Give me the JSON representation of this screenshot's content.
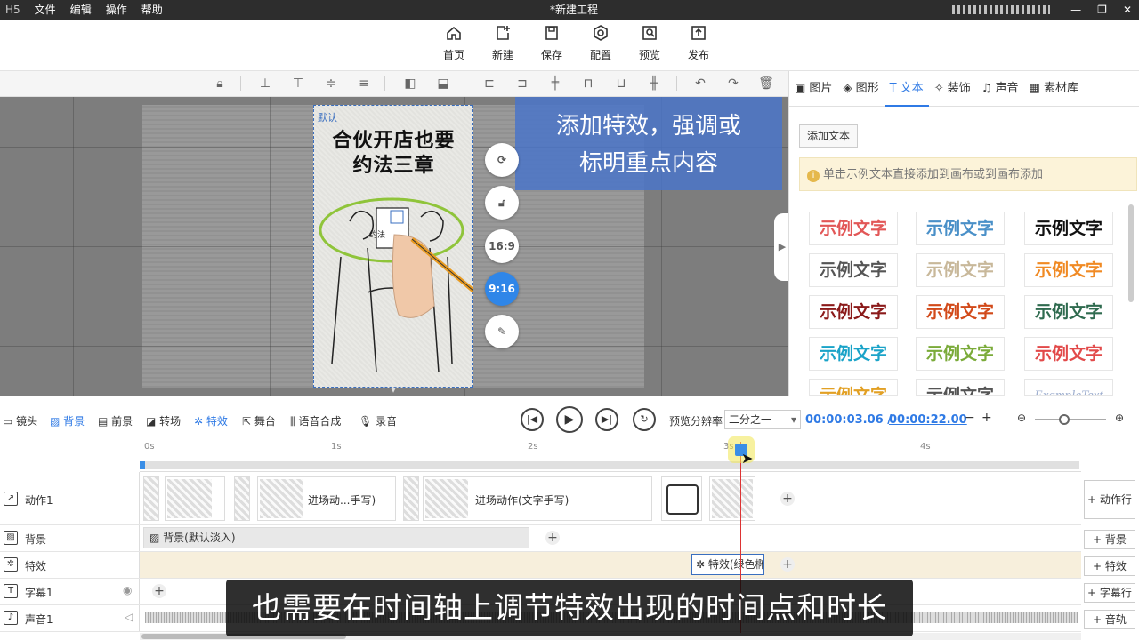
{
  "titlebar": {
    "logo": "H5",
    "menu": [
      "文件",
      "编辑",
      "操作",
      "帮助"
    ],
    "title": "*新建工程",
    "controls": [
      "—",
      "❐",
      "✕"
    ]
  },
  "main_toolbar": [
    {
      "label": "首页",
      "icon": "home-icon"
    },
    {
      "label": "新建",
      "icon": "new-file-icon"
    },
    {
      "label": "保存",
      "icon": "save-icon"
    },
    {
      "label": "配置",
      "icon": "settings-icon"
    },
    {
      "label": "预览",
      "icon": "preview-icon"
    },
    {
      "label": "发布",
      "icon": "publish-icon"
    }
  ],
  "align_icons": [
    "lock-icon",
    "align-bottom-icon",
    "align-top-icon",
    "align-middle-icon",
    "distribute-icon",
    "flip-horizontal-icon",
    "flip-vertical-icon",
    "align-left-icon",
    "align-right-icon",
    "align-center-icon",
    "align-top2-icon",
    "align-bottom2-icon",
    "align-vcenter-icon",
    "undo-icon",
    "redo-icon",
    "delete-icon"
  ],
  "canvas": {
    "card_tag": "默认",
    "card_title_line1": "合伙开店也要",
    "card_title_line2": "约法三章",
    "card_small": "约法",
    "overlay_line1": "添加特效，强调或",
    "overlay_line2": "标明重点内容",
    "side_buttons": [
      "rotate-icon",
      "unlock-icon",
      "16:9",
      "9:16",
      "edit-icon"
    ]
  },
  "right_panel": {
    "tabs": [
      "图片",
      "图形",
      "文本",
      "装饰",
      "声音",
      "素材库"
    ],
    "active_tab": "文本",
    "add_text": "添加文本",
    "hint": "单击示例文本直接添加到画布或到画布添加",
    "samples": [
      "示例文字",
      "示例文字",
      "示例文字",
      "示例文字",
      "示例文字",
      "示例文字",
      "示例文字",
      "示例文字",
      "示例文字",
      "示例文字",
      "示例文字",
      "示例文字",
      "示例文字",
      "示例文字",
      "ExampleText"
    ],
    "sample_colors": [
      "#e25757",
      "#4a90c8",
      "#111111",
      "#555555",
      "#c8b89a",
      "#f08a24",
      "#8b1a1a",
      "#d24a1a",
      "#2f6b4f",
      "#1aa3c8",
      "#7bab3a",
      "#e24a4a",
      "#e2a024",
      "#555555",
      "#a0b0d0"
    ]
  },
  "timeline_toolbar": {
    "items": [
      "镜头",
      "背景",
      "前景",
      "转场",
      "特效",
      "舞台",
      "语音合成",
      "录音"
    ],
    "active": "特效",
    "resolution_label": "预览分辨率",
    "resolution_value": "二分之一",
    "current_time": "00:00:03.06 /",
    "total_time": "00:00:22.00"
  },
  "ruler": {
    "ticks": [
      "0s",
      "1s",
      "2s",
      "3s",
      "4s"
    ]
  },
  "tracks": {
    "action": {
      "label": "动作1",
      "clip1": "进场动...手写)",
      "clip2": "进场动作(文字手写)",
      "add": "动作行"
    },
    "background": {
      "label": "背景",
      "clip": "背景(默认淡入)",
      "add": "背景"
    },
    "effect": {
      "label": "特效",
      "clip": "特效(绿色椭",
      "add": "特效"
    },
    "caption": {
      "label": "字幕1",
      "add": "字幕行"
    },
    "audio": {
      "label": "声音1",
      "add": "音轨"
    }
  },
  "subtitle": "也需要在时间轴上调节特效出现的时间点和时长"
}
